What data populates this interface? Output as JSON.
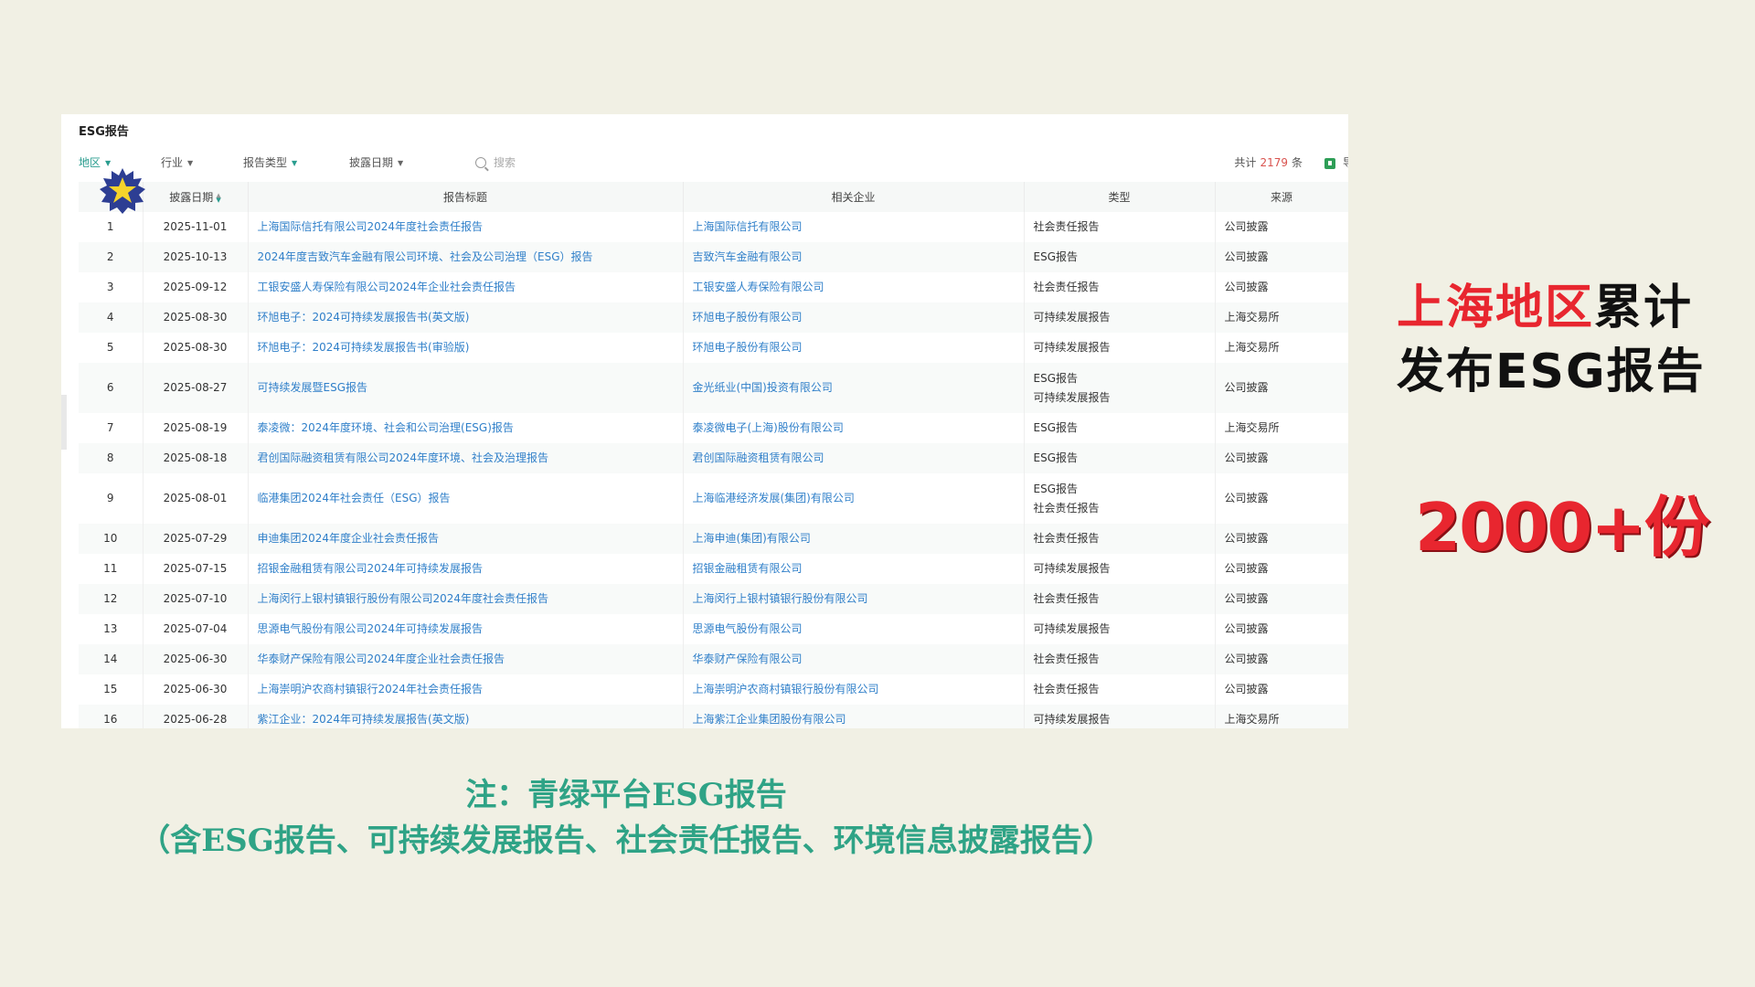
{
  "panel": {
    "title": "ESG报告",
    "filters": [
      {
        "label": "地区",
        "active": true
      },
      {
        "label": "行业",
        "active": false
      },
      {
        "label": "报告类型",
        "active": true
      },
      {
        "label": "披露日期",
        "active": false
      }
    ],
    "search_placeholder": "搜索",
    "total_prefix": "共计",
    "total_count": "2179",
    "total_suffix": "条",
    "export_label": "导"
  },
  "table": {
    "columns": [
      "",
      "披露日期",
      "报告标题",
      "相关企业",
      "类型",
      "来源"
    ],
    "rows": [
      {
        "idx": "1",
        "date": "2025-11-01",
        "title": "上海国际信托有限公司2024年度社会责任报告",
        "company": "上海国际信托有限公司",
        "type": "社会责任报告",
        "source": "公司披露"
      },
      {
        "idx": "2",
        "date": "2025-10-13",
        "title": "2024年度吉致汽车金融有限公司环境、社会及公司治理（ESG）报告",
        "company": "吉致汽车金融有限公司",
        "type": "ESG报告",
        "source": "公司披露"
      },
      {
        "idx": "3",
        "date": "2025-09-12",
        "title": "工银安盛人寿保险有限公司2024年企业社会责任报告",
        "company": "工银安盛人寿保险有限公司",
        "type": "社会责任报告",
        "source": "公司披露"
      },
      {
        "idx": "4",
        "date": "2025-08-30",
        "title": "环旭电子：2024可持续发展报告书(英文版)",
        "company": "环旭电子股份有限公司",
        "type": "可持续发展报告",
        "source": "上海交易所"
      },
      {
        "idx": "5",
        "date": "2025-08-30",
        "title": "环旭电子：2024可持续发展报告书(审验版)",
        "company": "环旭电子股份有限公司",
        "type": "可持续发展报告",
        "source": "上海交易所"
      },
      {
        "idx": "6",
        "date": "2025-08-27",
        "title": "可持续发展暨ESG报告",
        "company": "金光纸业(中国)投资有限公司",
        "type": "ESG报告",
        "type2": "可持续发展报告",
        "source": "公司披露"
      },
      {
        "idx": "7",
        "date": "2025-08-19",
        "title": "泰凌微：2024年度环境、社会和公司治理(ESG)报告",
        "company": "泰凌微电子(上海)股份有限公司",
        "type": "ESG报告",
        "source": "上海交易所"
      },
      {
        "idx": "8",
        "date": "2025-08-18",
        "title": "君创国际融资租赁有限公司2024年度环境、社会及治理报告",
        "company": "君创国际融资租赁有限公司",
        "type": "ESG报告",
        "source": "公司披露"
      },
      {
        "idx": "9",
        "date": "2025-08-01",
        "title": "临港集团2024年社会责任（ESG）报告",
        "company": "上海临港经济发展(集团)有限公司",
        "type": "ESG报告",
        "type2": "社会责任报告",
        "source": "公司披露"
      },
      {
        "idx": "10",
        "date": "2025-07-29",
        "title": "申迪集团2024年度企业社会责任报告",
        "company": "上海申迪(集团)有限公司",
        "type": "社会责任报告",
        "source": "公司披露"
      },
      {
        "idx": "11",
        "date": "2025-07-15",
        "title": "招银金融租赁有限公司2024年可持续发展报告",
        "company": "招银金融租赁有限公司",
        "type": "可持续发展报告",
        "source": "公司披露"
      },
      {
        "idx": "12",
        "date": "2025-07-10",
        "title": "上海闵行上银村镇银行股份有限公司2024年度社会责任报告",
        "company": "上海闵行上银村镇银行股份有限公司",
        "type": "社会责任报告",
        "source": "公司披露"
      },
      {
        "idx": "13",
        "date": "2025-07-04",
        "title": "思源电气股份有限公司2024年可持续发展报告",
        "company": "思源电气股份有限公司",
        "type": "可持续发展报告",
        "source": "公司披露"
      },
      {
        "idx": "14",
        "date": "2025-06-30",
        "title": "华泰财产保险有限公司2024年度企业社会责任报告",
        "company": "华泰财产保险有限公司",
        "type": "社会责任报告",
        "source": "公司披露"
      },
      {
        "idx": "15",
        "date": "2025-06-30",
        "title": "上海崇明沪农商村镇银行2024年社会责任报告",
        "company": "上海崇明沪农商村镇银行股份有限公司",
        "type": "社会责任报告",
        "source": "公司披露"
      },
      {
        "idx": "16",
        "date": "2025-06-28",
        "title": "紫江企业：2024年可持续发展报告(英文版)",
        "company": "上海紫江企业集团股份有限公司",
        "type": "可持续发展报告",
        "source": "上海交易所"
      }
    ]
  },
  "headline": {
    "line1_red": "上海地区",
    "line1_black": "累计",
    "line2": "发布ESG报告",
    "count": "2000+份"
  },
  "note": {
    "line1": "注：青绿平台ESG报告",
    "line2": "（含ESG报告、可持续发展报告、社会责任报告、环境信息披露报告）"
  },
  "colors": {
    "accent": "#2a9d8f",
    "link": "#2f7fc9",
    "headline_red": "#e8262f",
    "note_green": "#2fa386",
    "background": "#f1f0e4"
  }
}
